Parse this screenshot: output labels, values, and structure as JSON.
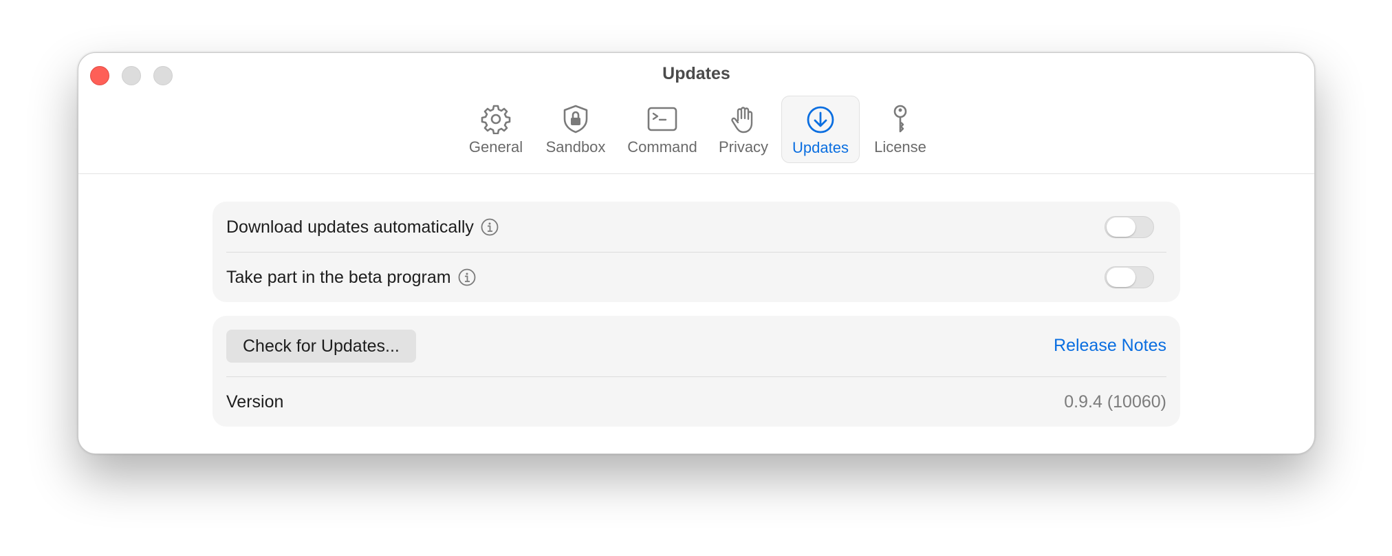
{
  "window": {
    "title": "Updates"
  },
  "toolbar": {
    "tabs": [
      {
        "label": "General",
        "icon": "gear-icon"
      },
      {
        "label": "Sandbox",
        "icon": "shield-lock-icon"
      },
      {
        "label": "Command",
        "icon": "terminal-icon"
      },
      {
        "label": "Privacy",
        "icon": "hand-icon"
      },
      {
        "label": "Updates",
        "icon": "download-circle-icon",
        "active": true
      },
      {
        "label": "License",
        "icon": "key-icon"
      }
    ]
  },
  "settings": {
    "auto_download": {
      "label": "Download updates automatically",
      "enabled": false
    },
    "beta_program": {
      "label": "Take part in the beta program",
      "enabled": false
    }
  },
  "actions": {
    "check_button": "Check for Updates...",
    "release_notes": "Release Notes"
  },
  "version": {
    "label": "Version",
    "value": "0.9.4 (10060)"
  },
  "colors": {
    "accent": "#0a6ee0",
    "close": "#fe5f57",
    "panel": "#f5f5f5"
  }
}
